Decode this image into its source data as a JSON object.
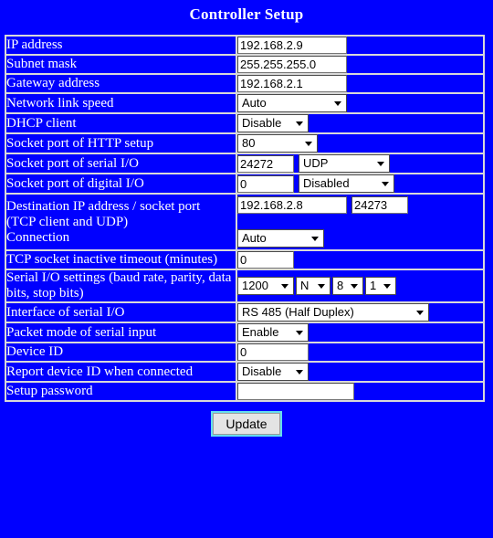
{
  "page": {
    "title": "Controller Setup"
  },
  "rows": [
    {
      "label": "IP address",
      "value": "192.168.2.9"
    },
    {
      "label": "Subnet mask",
      "value": "255.255.255.0"
    },
    {
      "label": "Gateway address",
      "value": "192.168.2.1"
    },
    {
      "label": "Network link speed",
      "value": "Auto"
    },
    {
      "label": "DHCP client",
      "value": "Disable"
    },
    {
      "label": "Socket port of HTTP setup",
      "value": "80"
    },
    {
      "label": "Socket port of serial I/O",
      "value": "24272",
      "value2": "UDP"
    },
    {
      "label": "Socket port of digital I/O",
      "value": "0",
      "value2": "Disabled"
    },
    {
      "label_line1": "Destination IP address / socket port",
      "label_line2": "(TCP client and UDP)",
      "label_line3": "Connection",
      "value": "192.168.2.8",
      "value2": "24273",
      "value3": "Auto"
    },
    {
      "label": "TCP socket inactive timeout (minutes)",
      "value": "0"
    },
    {
      "label_line1": "Serial I/O settings (baud rate, parity, data",
      "label_line2": "bits, stop bits)",
      "baud": "1200",
      "parity": "N",
      "data_bits": "8",
      "stop_bits": "1"
    },
    {
      "label": "Interface of serial I/O",
      "value": "RS 485 (Half Duplex)"
    },
    {
      "label": "Packet mode of serial input",
      "value": "Enable"
    },
    {
      "label": "Device ID",
      "value": "0"
    },
    {
      "label": "Report device ID when connected",
      "value": "Disable"
    },
    {
      "label": "Setup password",
      "value": ""
    }
  ],
  "footer": {
    "update_label": "Update"
  },
  "colors": {
    "background": "#0000ff",
    "text": "#ffffff",
    "border": "#d9d9d9",
    "field_background": "#ffffff",
    "button_focus": "#66ddee"
  }
}
